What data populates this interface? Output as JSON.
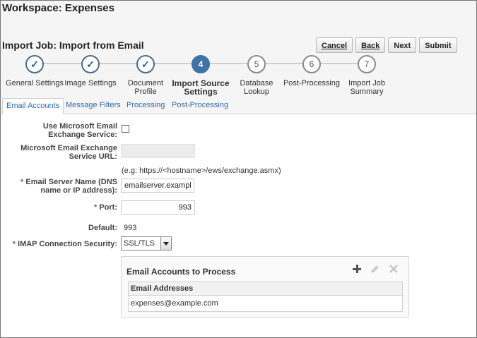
{
  "workspace_title": "Workspace: Expenses",
  "job_title": "Import Job: Import from Email",
  "buttons": {
    "cancel": "Cancel",
    "back": "Back",
    "next": "Next",
    "submit": "Submit"
  },
  "train": [
    {
      "number": "1",
      "label": "General Settings",
      "state": "done"
    },
    {
      "number": "2",
      "label": "Image Settings",
      "state": "done"
    },
    {
      "number": "3",
      "label": "Document\nProfile",
      "state": "done"
    },
    {
      "number": "4",
      "label": "Import Source\nSettings",
      "state": "current"
    },
    {
      "number": "5",
      "label": "Database\nLookup",
      "state": "todo"
    },
    {
      "number": "6",
      "label": "Post-Processing",
      "state": "todo"
    },
    {
      "number": "7",
      "label": "Import Job\nSummary",
      "state": "todo"
    }
  ],
  "tabs": [
    "Email Accounts",
    "Message Filters",
    "Processing",
    "Post-Processing"
  ],
  "form": {
    "use_exchange_label": "Use Microsoft Email Exchange Service:",
    "use_exchange_checked": false,
    "exchange_url_label": "Microsoft Email Exchange Service URL:",
    "exchange_url_value": "",
    "exchange_url_hint": "(e.g: https://<hostname>/ews/exchange.asmx)",
    "server_name_label": "Email Server Name (DNS name or IP address):",
    "server_name_value": "emailserver.example.c",
    "port_label": "Port:",
    "port_value": "993",
    "default_label": "Default:",
    "default_value": "993",
    "imap_label": "IMAP Connection Security:",
    "imap_value": "SSL/TLS",
    "required_marker": "*"
  },
  "accounts_panel": {
    "title": "Email Accounts to Process",
    "column_header": "Email Addresses",
    "rows": [
      "expenses@example.com"
    ],
    "tools": [
      "plus-icon",
      "edit-icon",
      "delete-icon"
    ]
  }
}
